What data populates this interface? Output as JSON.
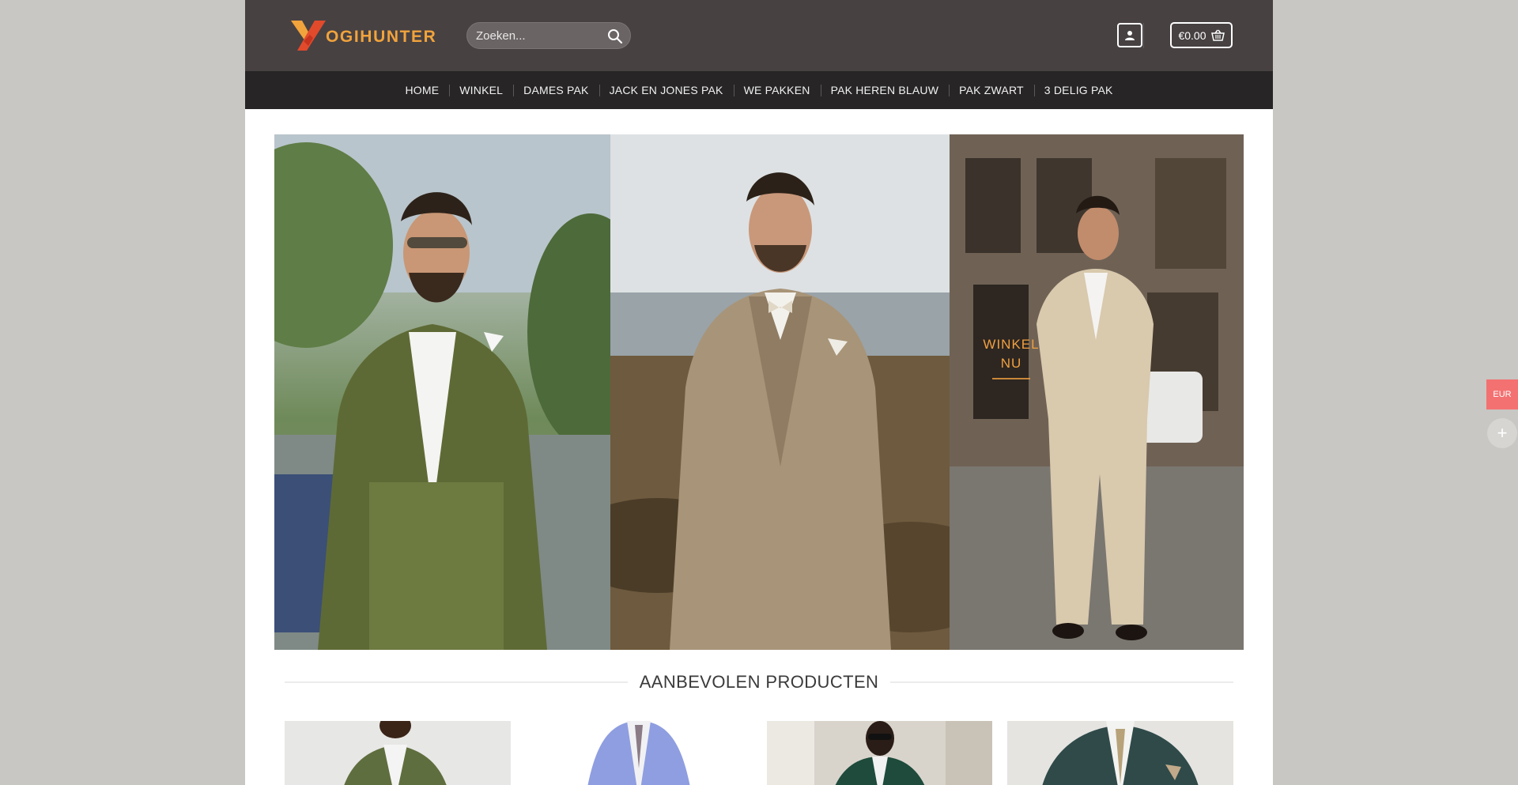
{
  "brand": {
    "name": "OGIHUNTER",
    "mark_letter": "Y",
    "accent_color": "#f1a33c"
  },
  "search": {
    "placeholder": "Zoeken..."
  },
  "header": {
    "account_icon": "user-icon",
    "cart_total": "€0.00",
    "cart_icon": "basket-icon"
  },
  "nav": {
    "items": [
      {
        "label": "HOME"
      },
      {
        "label": "WINKEL"
      },
      {
        "label": "DAMES PAK"
      },
      {
        "label": "JACK EN JONES PAK"
      },
      {
        "label": "WE PAKKEN"
      },
      {
        "label": "PAK HEREN BLAUW"
      },
      {
        "label": "PAK ZWART"
      },
      {
        "label": "3 DELIG PAK"
      }
    ]
  },
  "hero": {
    "cta_line1": "WINKEL",
    "cta_line2": "NU"
  },
  "featured": {
    "title": "AANBEVOLEN PRODUCTEN"
  },
  "floating": {
    "currency": "EUR",
    "plus": "+"
  }
}
